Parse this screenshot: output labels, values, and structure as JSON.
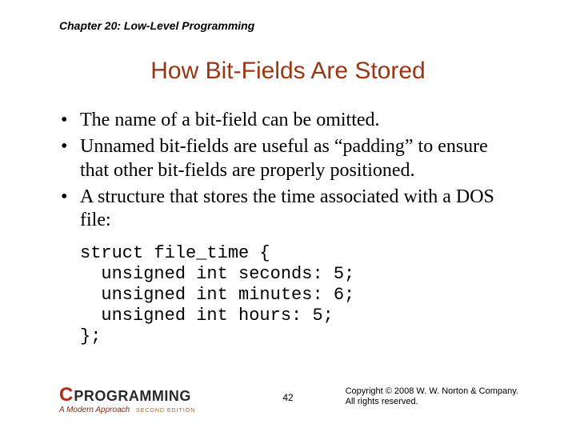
{
  "chapter": "Chapter 20: Low-Level Programming",
  "title": "How Bit-Fields Are Stored",
  "bullets": [
    "The name of a bit-field can be omitted.",
    "Unnamed bit-fields are useful as “padding” to ensure that other bit-fields are properly positioned.",
    "A structure that stores the time associated with a DOS file:"
  ],
  "code": "struct file_time {\n  unsigned int seconds: 5;\n  unsigned int minutes: 6;\n  unsigned int hours: 5;\n};",
  "logo": {
    "c": "C",
    "prog": "PROGRAMMING",
    "sub": "A Modern Approach",
    "edition": "SECOND EDITION"
  },
  "page": "42",
  "copyright_line1": "Copyright © 2008 W. W. Norton & Company.",
  "copyright_line2": "All rights reserved."
}
